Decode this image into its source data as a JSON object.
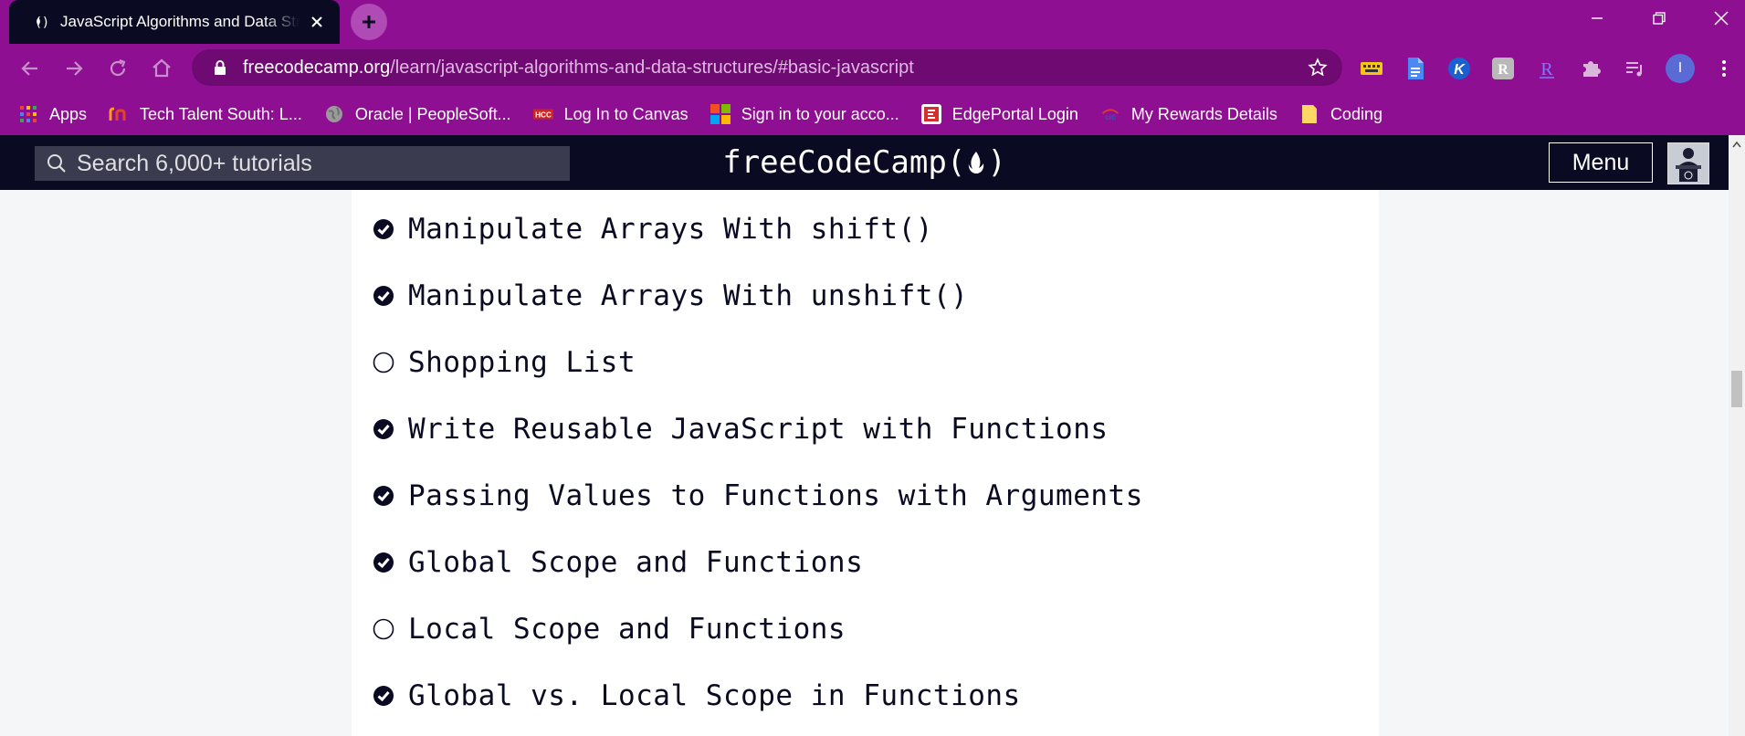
{
  "browser": {
    "tab": {
      "title": "JavaScript Algorithms and Data Structures",
      "favicon": "fcc-favicon-icon"
    },
    "address_bar": {
      "domain": "freecodecamp.org",
      "path": "/learn/javascript-algorithms-and-data-structures/#basic-javascript"
    },
    "bookmarks": [
      {
        "label": "Apps",
        "icon": "apps-grid-icon"
      },
      {
        "label": "Tech Talent South: L...",
        "icon": "tts-icon"
      },
      {
        "label": "Oracle | PeopleSoft...",
        "icon": "globe-icon"
      },
      {
        "label": "Log In to Canvas",
        "icon": "canvas-icon"
      },
      {
        "label": "Sign in to your acco...",
        "icon": "microsoft-icon"
      },
      {
        "label": "EdgePortal Login",
        "icon": "edgeportal-icon"
      },
      {
        "label": "My Rewards Details",
        "icon": "citi-icon"
      },
      {
        "label": "Coding",
        "icon": "folder-icon"
      }
    ],
    "extensions": [
      "keyboard-icon",
      "docs-icon",
      "k-extension-icon",
      "reader-icon",
      "r-extension-icon",
      "puzzle-icon",
      "playlist-icon"
    ],
    "profile_initial": "I"
  },
  "site": {
    "search_placeholder": "Search 6,000+ tutorials",
    "brand": {
      "prefix": "freeCodeCamp(",
      "suffix": ")"
    },
    "menu_label": "Menu"
  },
  "lessons": [
    {
      "title": "Manipulate Arrays With shift()",
      "completed": true
    },
    {
      "title": "Manipulate Arrays With unshift()",
      "completed": true
    },
    {
      "title": "Shopping List",
      "completed": false
    },
    {
      "title": "Write Reusable JavaScript with Functions",
      "completed": true
    },
    {
      "title": "Passing Values to Functions with Arguments",
      "completed": true
    },
    {
      "title": "Global Scope and Functions",
      "completed": true
    },
    {
      "title": "Local Scope and Functions",
      "completed": false
    },
    {
      "title": "Global vs. Local Scope in Functions",
      "completed": true
    }
  ],
  "colors": {
    "chrome": "#8e0f91",
    "fcc_dark": "#0a0a23",
    "content_bg": "#ffffff",
    "page_bg": "#f5f6f7"
  }
}
